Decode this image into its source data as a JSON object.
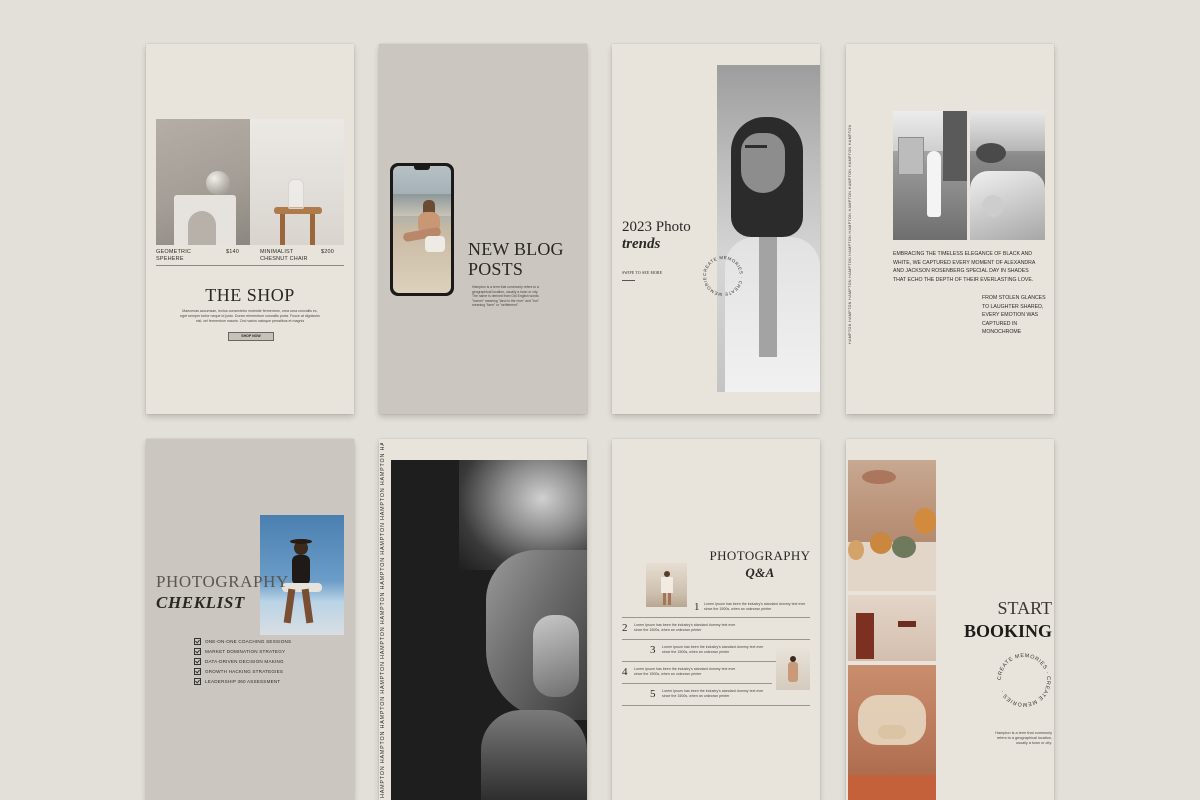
{
  "cards": {
    "shop": {
      "title": "THE SHOP",
      "product1_name_l1": "GEOMETRIC",
      "product1_name_l2": "SPEHERE",
      "product1_price": "$140",
      "product2_name_l1": "MINIMALIST",
      "product2_name_l2": "CHESNUT CHAIR",
      "product2_price": "$200",
      "body": "Maecenas accumsan, lectus consectetur molestie fermentum, urna urna convallis ex, eget semper tortor neque id justo. Donec elementum convallis porta. Fusce at dignissim nisl, vel fermentum mauris. Orci varius natoque penatibus et magnis",
      "button": "SHOP NOW"
    },
    "blog": {
      "title_l1": "NEW BLOG",
      "title_l2": "POSTS",
      "body": "Hampton is a term that commonly refers to a geographical location, usually a town or city. The name is derived from Old English words \"hamm\" meaning \"land in the river\" and \"tun\" meaning \"farm\" or \"settlement\"."
    },
    "trends": {
      "title_l1": "2023 Photo",
      "title_l2": "trends",
      "link": "SWIPE TO SEE MORE",
      "circle_text": "CREATE MEMORIES · CREATE MEMORIES ·"
    },
    "monochrome": {
      "side_text": "HAMPTON HAMPTON HAMPTON HAMPTON HAMPTON HAMPTON HAMPTON HAMPTON HAMPTON HAMPTON",
      "para1": "EMBRACING THE TIMELESS ELEGANCE OF BLACK AND WHITE, WE CAPTURED EVERY MOMENT OF ALEXANDRA AND JACKSON ROSENBERG SPECIAL DAY IN SHADES THAT ECHO THE DEPTH OF THEIR EVERLASTING LOVE.",
      "para2": "FROM STOLEN GLANCES TO LAUGHTER SHARED, EVERY EMOTION WAS CAPTURED IN MONOCHROME"
    },
    "checklist": {
      "title_l1": "PHOTOGRAPHY",
      "title_l2": "CHEKLIST",
      "items": [
        "ONE-ON-ONE COACHING SESSIONS",
        "MARKET DOMINATION STRATEGY",
        "DATA-DRIVEN DECISION MAKING",
        "GROWTH HACKING STRATEGIES",
        "LEADERSHIP 360 ASSESSMENT"
      ]
    },
    "hampton": {
      "side_text": "HAMPTON HAMPTON HAMPTON HAMPTON HAMPTON HAMPTON HAMPTON HAMPTON HAMPTON HAMPTON HAMPTON HAMPTON HAMPTON HAMPTON HAMPTON HAMPTON HAMPTON"
    },
    "qa": {
      "title_l1": "PHOTOGRAPHY",
      "title_l2": "Q&A",
      "items": [
        {
          "num": "1",
          "text": "Lorem Ipsum has been the industry's standard dummy text ever since the 1500s, when an unknown printer"
        },
        {
          "num": "2",
          "text": "Lorem Ipsum has been the industry's standard dummy text ever since the 1500s, when an unknown printer"
        },
        {
          "num": "3",
          "text": "Lorem Ipsum has been the industry's standard dummy text ever since the 1500s, when an unknown printer"
        },
        {
          "num": "4",
          "text": "Lorem Ipsum has been the industry's standard dummy text ever since the 1500s, when an unknown printer"
        },
        {
          "num": "5",
          "text": "Lorem Ipsum has been the industry's standard dummy text ever since the 1500s, when an unknown printer"
        }
      ]
    },
    "booking": {
      "title_l1": "START",
      "title_l2": "BOOKING",
      "circle_text": "CREATE MEMORIES · CREATE MEMORIES ·",
      "body": "Hampton is a term that commonly refers to a geographical location, usually a town or city."
    }
  }
}
